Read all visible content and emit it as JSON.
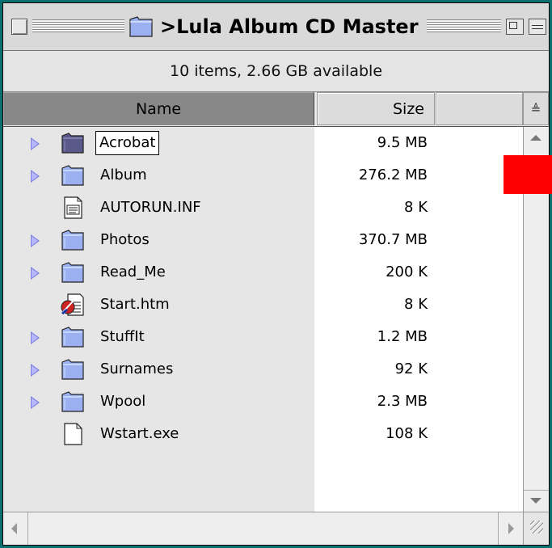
{
  "window": {
    "title": ">Lula Album CD Master",
    "info": "10 items, 2.66 GB available"
  },
  "columns": {
    "name": "Name",
    "size": "Size"
  },
  "files": [
    {
      "name": "Acrobat",
      "size": "9.5 MB",
      "kind": "folder",
      "expandable": true,
      "selected": true
    },
    {
      "name": "Album",
      "size": "276.2 MB",
      "kind": "folder",
      "expandable": true
    },
    {
      "name": "AUTORUN.INF",
      "size": "8 K",
      "kind": "document",
      "expandable": false
    },
    {
      "name": "Photos",
      "size": "370.7 MB",
      "kind": "folder",
      "expandable": true
    },
    {
      "name": "Read_Me",
      "size": "200 K",
      "kind": "folder",
      "expandable": true
    },
    {
      "name": "Start.htm",
      "size": "8 K",
      "kind": "html",
      "expandable": false
    },
    {
      "name": "StuffIt",
      "size": "1.2 MB",
      "kind": "folder",
      "expandable": true
    },
    {
      "name": "Surnames",
      "size": "92 K",
      "kind": "folder",
      "expandable": true
    },
    {
      "name": "Wpool",
      "size": "2.3 MB",
      "kind": "folder",
      "expandable": true
    },
    {
      "name": "Wstart.exe",
      "size": "108 K",
      "kind": "blank-document",
      "expandable": false
    }
  ],
  "colors": {
    "desktop": "#0a6f6f",
    "highlight": "#ff0000",
    "sorted_column": "#888888"
  }
}
